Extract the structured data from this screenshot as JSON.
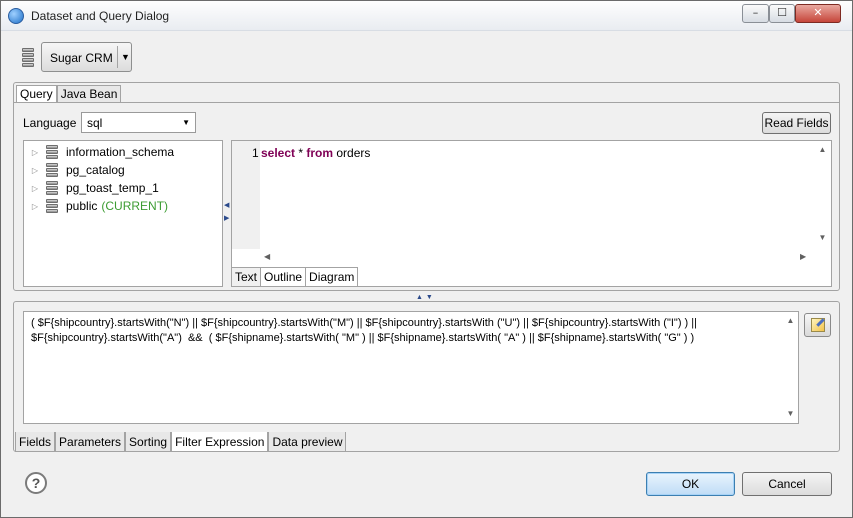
{
  "window": {
    "title": "Dataset and Query Dialog",
    "minimize_glyph": "–",
    "maximize_glyph": "☐",
    "close_glyph": "✕",
    "icon": "app-logo-icon"
  },
  "datasource": {
    "selected": "Sugar CRM",
    "dropdown_glyph": "▼",
    "icon": "database-icon"
  },
  "top_tabs": [
    {
      "label": "Query",
      "active": true
    },
    {
      "label": "Java Bean",
      "active": false
    }
  ],
  "language": {
    "label": "Language",
    "value": "sql",
    "dropdown_glyph": "▼"
  },
  "read_fields_label": "Read Fields",
  "tree": {
    "items": [
      {
        "name": "information_schema",
        "suffix": ""
      },
      {
        "name": "pg_catalog",
        "suffix": ""
      },
      {
        "name": "pg_toast_temp_1",
        "suffix": ""
      },
      {
        "name": "public",
        "suffix": "(CURRENT)"
      }
    ],
    "expand_glyph": "▷"
  },
  "editor": {
    "line_number": "1",
    "kw_select": "select",
    "star": " * ",
    "kw_from": "from",
    "table": " orders",
    "tabs": [
      {
        "label": "Text",
        "active": true
      },
      {
        "label": "Outline",
        "active": false
      },
      {
        "label": "Diagram",
        "active": false
      }
    ],
    "scroll_up": "▲",
    "scroll_down": "▼",
    "scroll_left": "◀",
    "scroll_right": "▶"
  },
  "side_splitter": {
    "left": "◀",
    "right": "▶"
  },
  "sash_glyph": "▲▼",
  "filter_expression": "( $F{shipcountry}.startsWith(\"N\") || $F{shipcountry}.startsWith(\"M\") || $F{shipcountry}.startsWith (\"U\") || $F{shipcountry}.startsWith (\"I\") ) ||  $F{shipcountry}.startsWith(\"A\")  &&  ( $F{shipname}.startsWith( \"M\" ) || $F{shipname}.startsWith( \"A\" ) || $F{shipname}.startsWith( \"G\" ) )",
  "expression_button_icon": "expression-editor-icon",
  "bottom_tabs": [
    {
      "label": "Fields",
      "active": false
    },
    {
      "label": "Parameters",
      "active": false
    },
    {
      "label": "Sorting",
      "active": false
    },
    {
      "label": "Filter Expression",
      "active": true
    },
    {
      "label": "Data preview",
      "active": false
    }
  ],
  "help_glyph": "?",
  "ok_label": "OK",
  "cancel_label": "Cancel"
}
